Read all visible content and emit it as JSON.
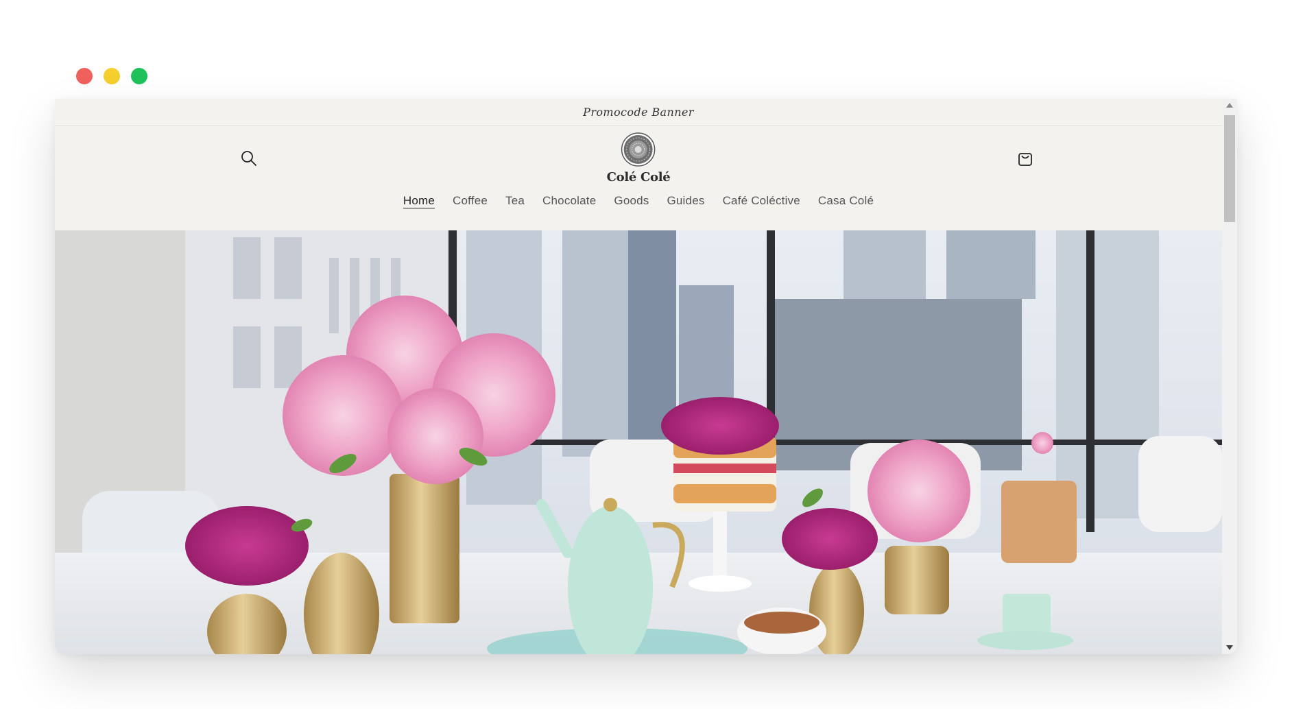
{
  "window_controls": {
    "close_color": "#f0605d",
    "minimize_color": "#f5cf2e",
    "maximize_color": "#1fc15a"
  },
  "announcement": {
    "text": "Promocode Banner"
  },
  "header": {
    "logo_text": "Colé Colé",
    "search_icon": "search-icon",
    "cart_icon": "cart-icon"
  },
  "nav": {
    "items": [
      {
        "label": "Home",
        "active": true
      },
      {
        "label": "Coffee"
      },
      {
        "label": "Tea"
      },
      {
        "label": "Chocolate"
      },
      {
        "label": "Goods"
      },
      {
        "label": "Guides"
      },
      {
        "label": "Café Coléctive"
      },
      {
        "label": "Casa Colé"
      }
    ]
  },
  "colors": {
    "page_background": "#f3f2ef",
    "text_primary": "#222222",
    "text_nav": "#555555"
  }
}
